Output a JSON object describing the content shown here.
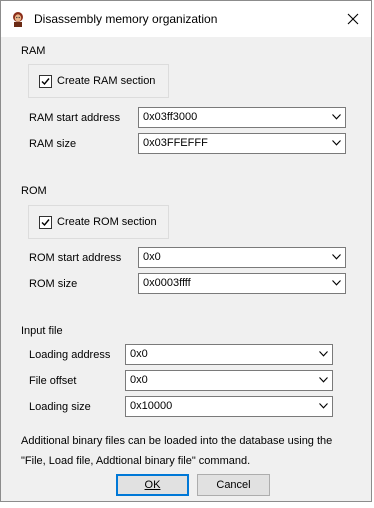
{
  "window": {
    "title": "Disassembly memory organization",
    "close_glyph": "✕"
  },
  "ram": {
    "section_label": "RAM",
    "create_label": "Create RAM section",
    "create_checked": true,
    "start_label": "RAM start address",
    "start_value": "0x03ff3000",
    "size_label": "RAM size",
    "size_value": "0x03FFEFFF"
  },
  "rom": {
    "section_label": "ROM",
    "create_label": "Create ROM section",
    "create_checked": true,
    "start_label": "ROM start address",
    "start_value": "0x0",
    "size_label": "ROM size",
    "size_value": "0x0003ffff"
  },
  "input_file": {
    "section_label": "Input file",
    "loading_address_label": "Loading address",
    "loading_address_value": "0x0",
    "file_offset_label": "File offset",
    "file_offset_value": "0x0",
    "loading_size_label": "Loading size",
    "loading_size_value": "0x10000"
  },
  "info": {
    "line1": "Additional binary files can be loaded into the database using the",
    "line2": "\"File, Load file, Addtional binary file\" command."
  },
  "buttons": {
    "ok_label": "OK",
    "cancel_label": "Cancel"
  },
  "icons": {
    "app": "ida-app-icon",
    "close": "close-icon",
    "dropdown": "chevron-down-icon",
    "check": "checkmark-icon"
  }
}
